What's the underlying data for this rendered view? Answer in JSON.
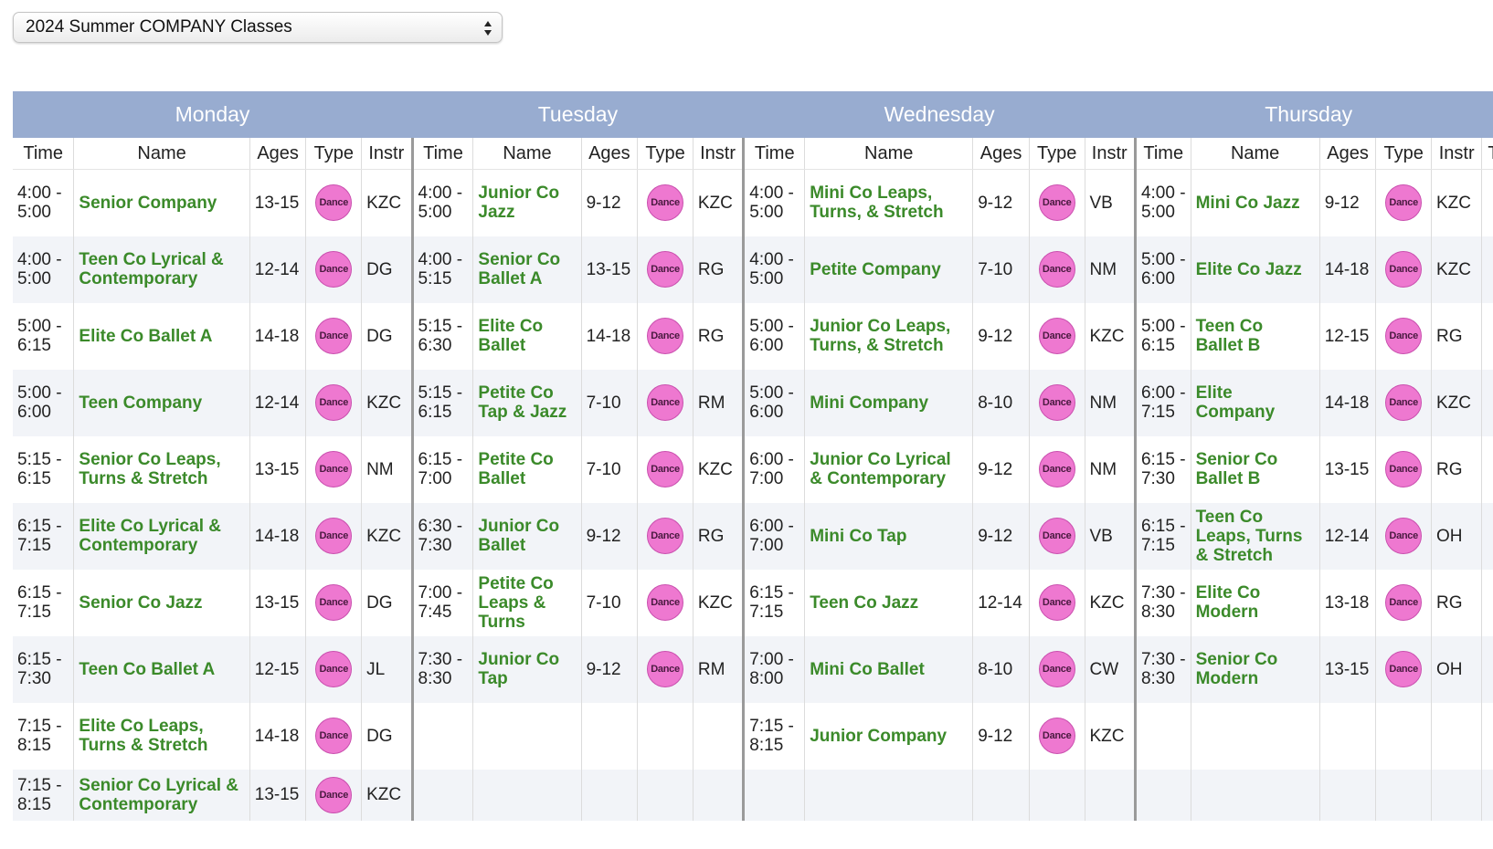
{
  "season_select": {
    "selected": "2024 Summer COMPANY Classes"
  },
  "type_badge": "Dance",
  "columns": [
    "Time",
    "Name",
    "Ages",
    "Type",
    "Instr"
  ],
  "partial_column_label": "T",
  "days": [
    {
      "name": "Monday",
      "rows": [
        {
          "time": "4:00 - 5:00",
          "name": "Senior Company",
          "ages": "13-15",
          "instr": "KZC"
        },
        {
          "time": "4:00 - 5:00",
          "name": "Teen Co Lyrical & Contemporary",
          "ages": "12-14",
          "instr": "DG"
        },
        {
          "time": "5:00 - 6:15",
          "name": "Elite Co Ballet A",
          "ages": "14-18",
          "instr": "DG"
        },
        {
          "time": "5:00 - 6:00",
          "name": "Teen Company",
          "ages": "12-14",
          "instr": "KZC"
        },
        {
          "time": "5:15 - 6:15",
          "name": "Senior Co Leaps, Turns & Stretch",
          "ages": "13-15",
          "instr": "NM"
        },
        {
          "time": "6:15 - 7:15",
          "name": "Elite Co Lyrical & Contemporary",
          "ages": "14-18",
          "instr": "KZC"
        },
        {
          "time": "6:15 - 7:15",
          "name": "Senior Co Jazz",
          "ages": "13-15",
          "instr": "DG"
        },
        {
          "time": "6:15 - 7:30",
          "name": "Teen Co Ballet A",
          "ages": "12-15",
          "instr": "JL"
        },
        {
          "time": "7:15 - 8:15",
          "name": "Elite Co Leaps, Turns & Stretch",
          "ages": "14-18",
          "instr": "DG"
        },
        {
          "time": "7:15 - 8:15",
          "name": "Senior Co Lyrical & Contemporary",
          "ages": "13-15",
          "instr": "KZC"
        }
      ]
    },
    {
      "name": "Tuesday",
      "rows": [
        {
          "time": "4:00 - 5:00",
          "name": "Junior Co Jazz",
          "ages": "9-12",
          "instr": "KZC"
        },
        {
          "time": "4:00 - 5:15",
          "name": "Senior Co Ballet A",
          "ages": "13-15",
          "instr": "RG"
        },
        {
          "time": "5:15 - 6:30",
          "name": "Elite Co Ballet",
          "ages": "14-18",
          "instr": "RG"
        },
        {
          "time": "5:15 - 6:15",
          "name": "Petite Co Tap & Jazz",
          "ages": "7-10",
          "instr": "RM"
        },
        {
          "time": "6:15 - 7:00",
          "name": "Petite Co Ballet",
          "ages": "7-10",
          "instr": "KZC"
        },
        {
          "time": "6:30 - 7:30",
          "name": "Junior Co Ballet",
          "ages": "9-12",
          "instr": "RG"
        },
        {
          "time": "7:00 - 7:45",
          "name": "Petite Co Leaps & Turns",
          "ages": "7-10",
          "instr": "KZC"
        },
        {
          "time": "7:30 - 8:30",
          "name": "Junior Co Tap",
          "ages": "9-12",
          "instr": "RM"
        }
      ]
    },
    {
      "name": "Wednesday",
      "rows": [
        {
          "time": "4:00 - 5:00",
          "name": "Mini Co Leaps, Turns, & Stretch",
          "ages": "9-12",
          "instr": "VB"
        },
        {
          "time": "4:00 - 5:00",
          "name": "Petite Company",
          "ages": "7-10",
          "instr": "NM"
        },
        {
          "time": "5:00 - 6:00",
          "name": "Junior Co Leaps, Turns, & Stretch",
          "ages": "9-12",
          "instr": "KZC"
        },
        {
          "time": "5:00 - 6:00",
          "name": "Mini Company",
          "ages": "8-10",
          "instr": "NM"
        },
        {
          "time": "6:00 - 7:00",
          "name": "Junior Co Lyrical & Contemporary",
          "ages": "9-12",
          "instr": "NM"
        },
        {
          "time": "6:00 - 7:00",
          "name": "Mini Co Tap",
          "ages": "9-12",
          "instr": "VB"
        },
        {
          "time": "6:15 - 7:15",
          "name": "Teen Co Jazz",
          "ages": "12-14",
          "instr": "KZC"
        },
        {
          "time": "7:00 - 8:00",
          "name": "Mini Co Ballet",
          "ages": "8-10",
          "instr": "CW"
        },
        {
          "time": "7:15 - 8:15",
          "name": "Junior Company",
          "ages": "9-12",
          "instr": "KZC"
        }
      ]
    },
    {
      "name": "Thursday",
      "rows": [
        {
          "time": "4:00 - 5:00",
          "name": "Mini Co Jazz",
          "ages": "9-12",
          "instr": "KZC"
        },
        {
          "time": "5:00 - 6:00",
          "name": "Elite Co Jazz",
          "ages": "14-18",
          "instr": "KZC"
        },
        {
          "time": "5:00 - 6:15",
          "name": "Teen Co Ballet B",
          "ages": "12-15",
          "instr": "RG"
        },
        {
          "time": "6:00 - 7:15",
          "name": "Elite Company",
          "ages": "14-18",
          "instr": "KZC"
        },
        {
          "time": "6:15 - 7:30",
          "name": "Senior Co Ballet B",
          "ages": "13-15",
          "instr": "RG"
        },
        {
          "time": "6:15 - 7:15",
          "name": "Teen Co Leaps, Turns & Stretch",
          "ages": "12-14",
          "instr": "OH"
        },
        {
          "time": "7:30 - 8:30",
          "name": "Elite Co Modern",
          "ages": "13-18",
          "instr": "RG"
        },
        {
          "time": "7:30 - 8:30",
          "name": "Senior Co Modern",
          "ages": "13-15",
          "instr": "OH"
        }
      ]
    }
  ]
}
